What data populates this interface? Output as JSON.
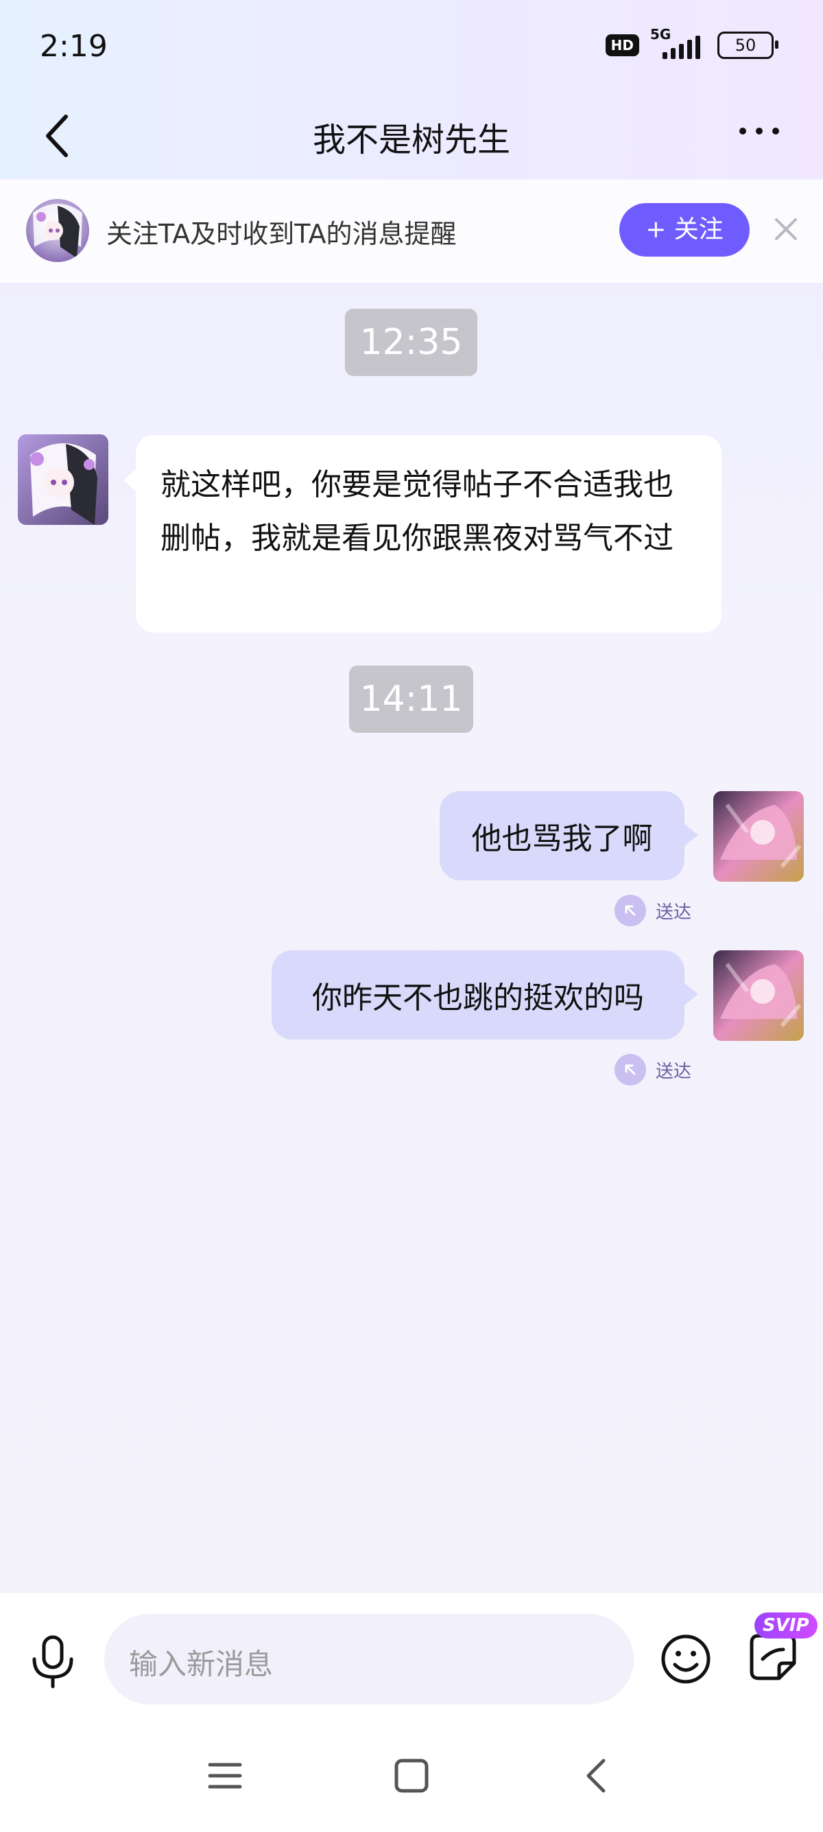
{
  "status_bar": {
    "time": "2:19",
    "hd_label": "HD",
    "network": "5G",
    "battery": "50"
  },
  "header": {
    "title": "我不是树先生"
  },
  "follow_bar": {
    "text": "关注TA及时收到TA的消息提醒",
    "button_label": "+ 关注"
  },
  "messages": [
    {
      "type": "timestamp",
      "text": "12:35"
    },
    {
      "type": "incoming",
      "text": "就这样吧，你要是觉得帖子不合适我也删帖，我就是看见你跟黑夜对骂气不过"
    },
    {
      "type": "timestamp",
      "text": "14:11"
    },
    {
      "type": "outgoing",
      "text": "他也骂我了啊",
      "status": "送达"
    },
    {
      "type": "outgoing",
      "text": "你昨天不也跳的挺欢的吗",
      "status": "送达"
    }
  ],
  "input_bar": {
    "placeholder": "输入新消息",
    "svip_badge": "SVIP"
  },
  "colors": {
    "accent": "#6f5cff",
    "outgoing_bubble": "#d9d9fb",
    "incoming_bubble": "#ffffff",
    "timestamp_bg": "#c6c5cc"
  },
  "icons": [
    "back-icon",
    "more-icon",
    "close-icon",
    "microphone-icon",
    "emoji-icon",
    "sticker-icon",
    "menu-icon",
    "home-icon",
    "nav-back-icon",
    "delivered-icon"
  ]
}
